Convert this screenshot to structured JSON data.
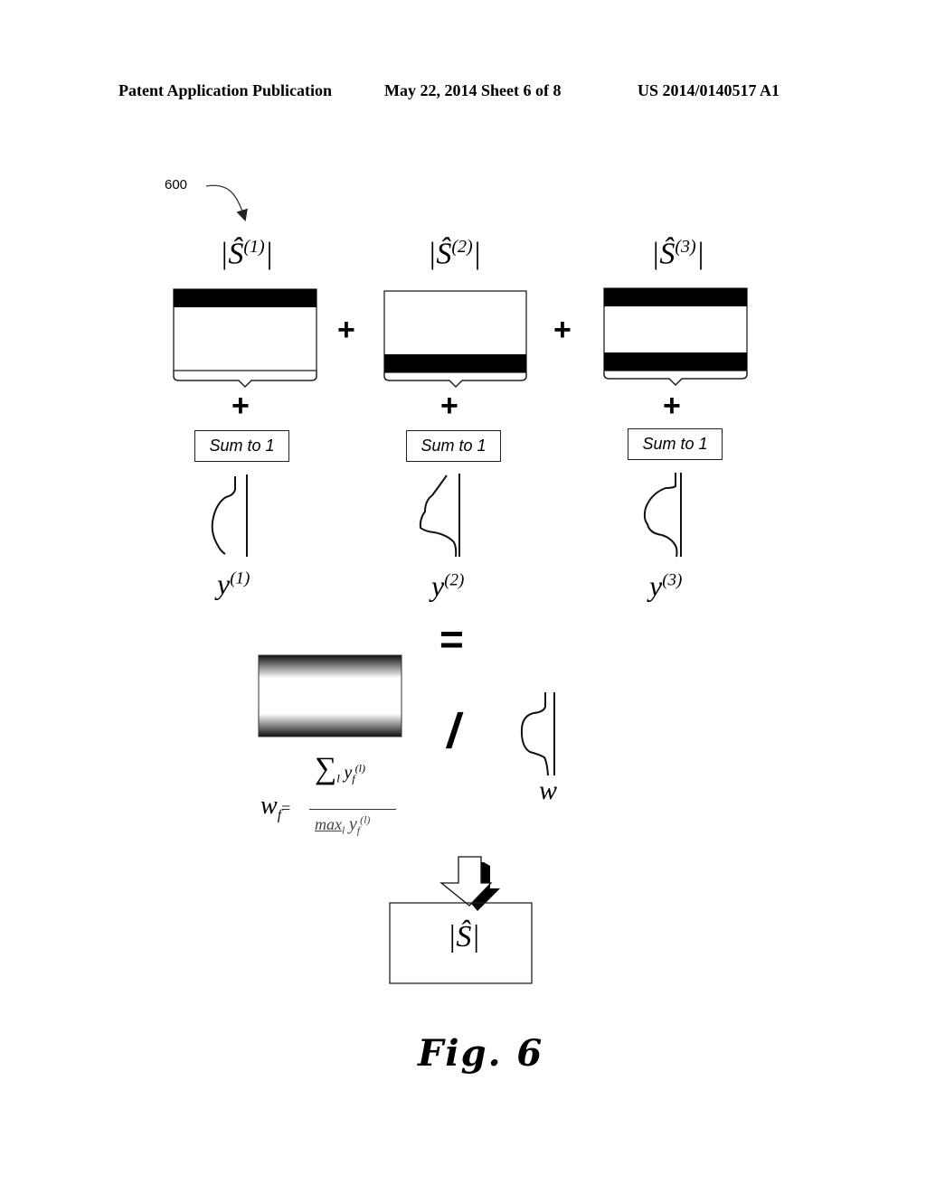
{
  "header": {
    "left": "Patent Application Publication",
    "center": "May 22, 2014  Sheet 6 of 8",
    "right": "US 2014/0140517 A1"
  },
  "figure": {
    "reference_number": "600",
    "caption": "Fig. 6",
    "components": [
      {
        "label_base": "|Ŝ",
        "label_sup": "(1)",
        "bands": [
          "top"
        ],
        "sum_label": "Sum to 1",
        "curve_label_base": "y",
        "curve_label_sup": "(1)"
      },
      {
        "label_base": "|Ŝ",
        "label_sup": "(2)",
        "bands": [
          "bottom"
        ],
        "sum_label": "Sum to 1",
        "curve_label_base": "y",
        "curve_label_sup": "(2)"
      },
      {
        "label_base": "|Ŝ",
        "label_sup": "(3)",
        "bands": [
          "top",
          "bottom"
        ],
        "sum_label": "Sum to 1",
        "curve_label_base": "y",
        "curve_label_sup": "(3)"
      }
    ],
    "operators": {
      "plus": "+",
      "equals": "=",
      "divide": "/"
    },
    "weight_label": "w",
    "formula": {
      "lhs": "w",
      "lhs_sub": "f",
      "eq": "=",
      "numerator_sum": "∑",
      "numerator_index": "l",
      "numerator_var": "y",
      "numerator_sub": "f",
      "numerator_sup": "(l)",
      "denominator_op": "max",
      "denominator_index": "l",
      "denominator_var": "y",
      "denominator_sub": "f",
      "denominator_sup": "(l)"
    },
    "result_label": "|Ŝ|",
    "label_close": "|"
  }
}
